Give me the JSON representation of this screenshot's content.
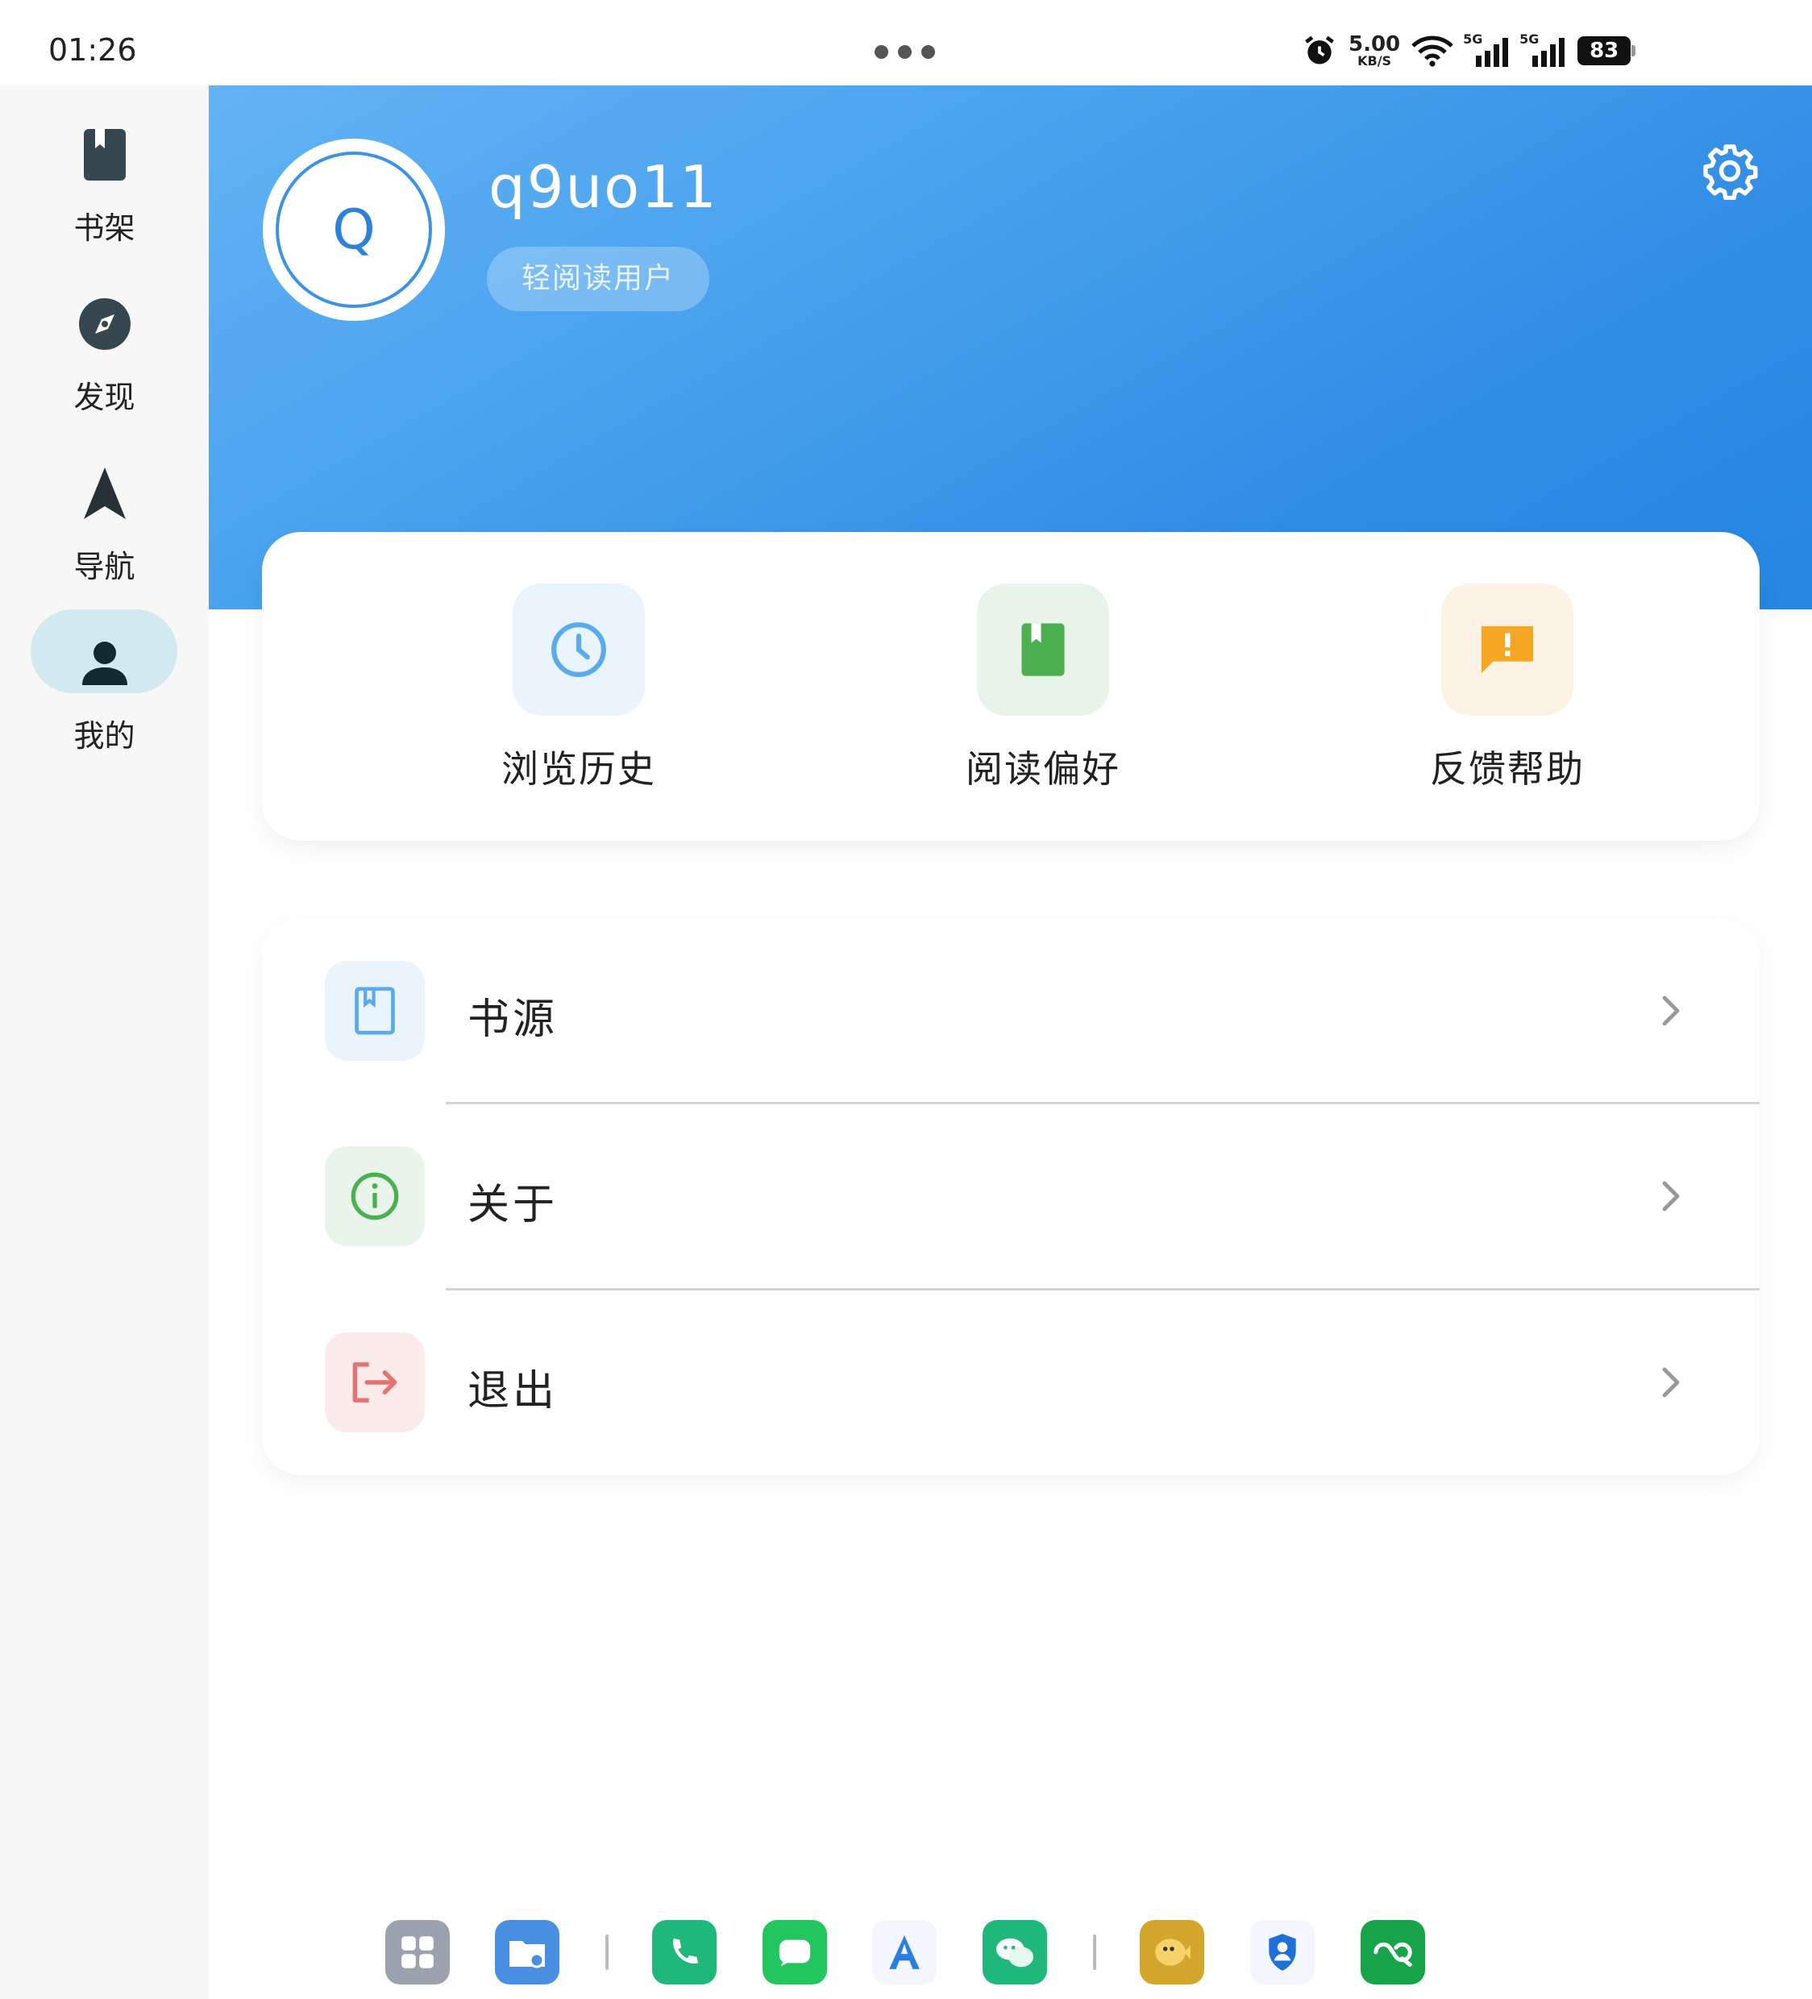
{
  "status_bar": {
    "time": "01:26",
    "net_speed_value": "5.00",
    "net_speed_unit": "KB/S",
    "signal_1_label": "5G",
    "signal_2_label": "5G",
    "battery": "83"
  },
  "sidebar": {
    "items": [
      {
        "label": "书架",
        "icon": "bookmark-book-icon",
        "active": false
      },
      {
        "label": "发现",
        "icon": "compass-icon",
        "active": false
      },
      {
        "label": "导航",
        "icon": "navigation-arrow-icon",
        "active": false
      },
      {
        "label": "我的",
        "icon": "person-icon",
        "active": true
      }
    ]
  },
  "profile": {
    "avatar_letter": "Q",
    "username": "q9uo11",
    "user_tag": "轻阅读用户"
  },
  "quick_actions": [
    {
      "label": "浏览历史",
      "icon": "clock-icon",
      "color": "#5aaaf0",
      "bg": "#eaf4fd"
    },
    {
      "label": "阅读偏好",
      "icon": "book-icon",
      "color": "#4caf50",
      "bg": "#e9f5ea"
    },
    {
      "label": "反馈帮助",
      "icon": "feedback-icon",
      "color": "#f5a623",
      "bg": "#fdf3e5"
    }
  ],
  "menu": [
    {
      "label": "书源",
      "icon": "book-source-icon",
      "color": "#5aaaf0",
      "bg": "#eaf4fd"
    },
    {
      "label": "关于",
      "icon": "info-icon",
      "color": "#4caf50",
      "bg": "#e9f5ea"
    },
    {
      "label": "退出",
      "icon": "logout-icon",
      "color": "#e57373",
      "bg": "#fcebeb"
    }
  ],
  "colors": {
    "header_start": "#63b3f5",
    "header_end": "#2587e2",
    "active_nav": "#d2e9ef"
  }
}
